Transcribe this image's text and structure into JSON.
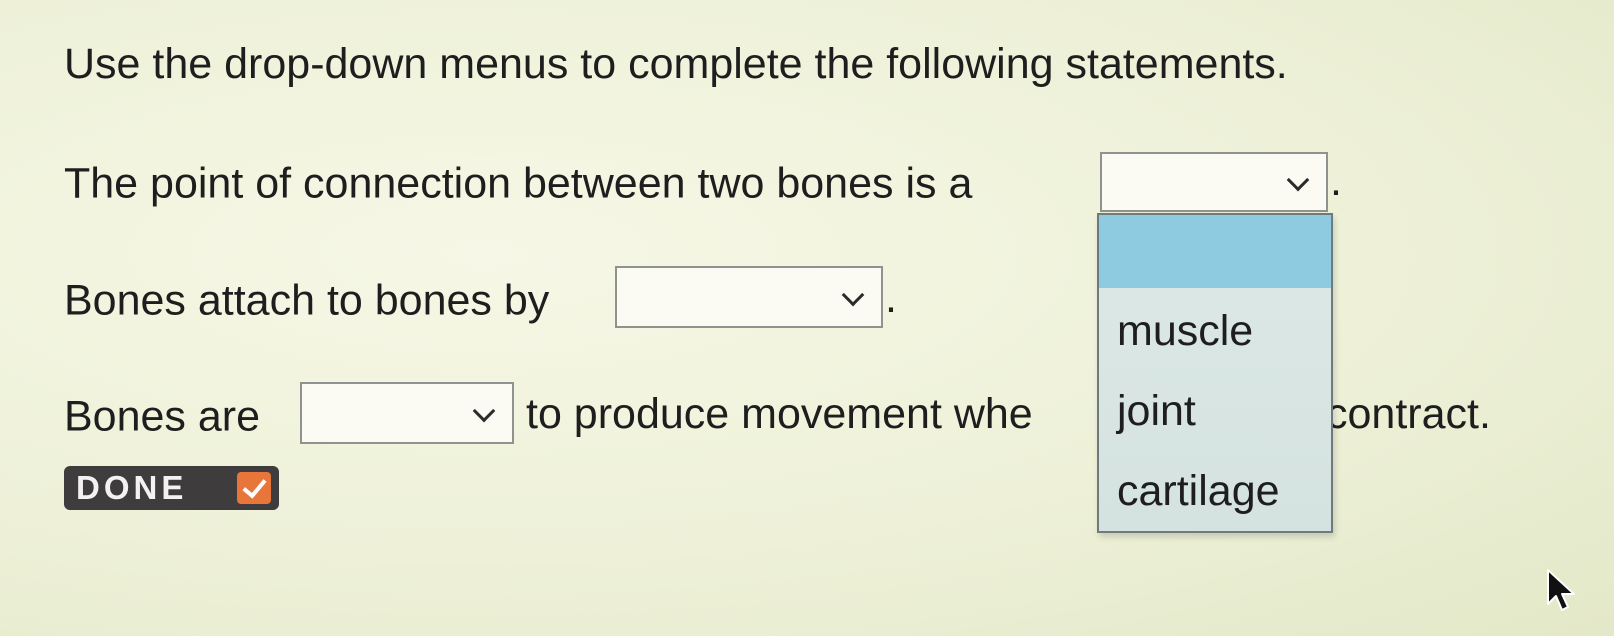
{
  "instructions": "Use the drop-down menus to complete the following statements.",
  "statements": [
    {
      "before": "The point of connection between two bones is a",
      "after": ".",
      "selected": ""
    },
    {
      "before": "Bones attach to bones by",
      "after": ".",
      "selected": ""
    },
    {
      "before": "Bones are",
      "middle_visible": "to produce movement whe",
      "end_visible": "contract.",
      "selected": ""
    }
  ],
  "dropdown": {
    "open_for_statement": 1,
    "options": [
      "",
      "muscle",
      "joint",
      "cartilage"
    ],
    "highlighted_index": 0
  },
  "done_button": {
    "label": "DONE",
    "icon": "checkmark-icon"
  },
  "colors": {
    "dropdown_highlight": "#8fcbe0",
    "done_bg": "#3e3c3c",
    "done_check_bg": "#e8763a"
  },
  "icons": {
    "select_chevron": "chevron-down-icon",
    "cursor": "mouse-pointer-icon"
  }
}
